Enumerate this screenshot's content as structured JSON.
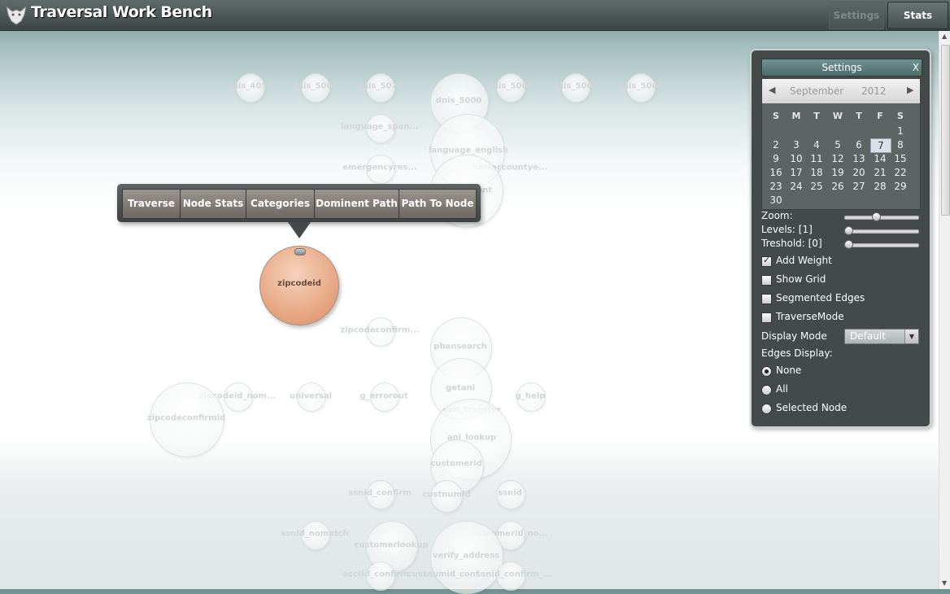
{
  "header": {
    "app_title": "Traversal Work Bench",
    "settings_button": "Settings",
    "stats_button": "Stats"
  },
  "context_menu": [
    "Traverse",
    "Node Stats",
    "Categories",
    "Dominent Path",
    "Path To Node"
  ],
  "selected_node": "zipcodeid",
  "graph_nodes": [
    "dnis_4058",
    "dnis_5002",
    "dnis_5075",
    "dnis_5000",
    "dnis_5004",
    "dnis_5001",
    "dnis_5003",
    "language_span...",
    "language_english",
    "emergencyres...",
    "newaccountye...",
    "...ant",
    "zipcodeconfirm...",
    "pbansearch",
    "zipcodeid_nom...",
    "universal",
    "g_errorout",
    "getani",
    "g_help",
    "zipcodeconfirmid",
    "exit_transfer",
    "ani_lookup",
    "customerid",
    "ssnid_confirm",
    "custnumid",
    "ssnid",
    "ssnid_nomatch",
    "customerlookup",
    "customerid_no...",
    "verify_address",
    "acctid_confirm",
    "custnumid_conf",
    "ssnid_confirm_..."
  ],
  "settings": {
    "title": "Settings",
    "close": "X",
    "calendar": {
      "month": "September",
      "year": "2012",
      "weekdays": [
        "S",
        "M",
        "T",
        "W",
        "T",
        "F",
        "S"
      ],
      "selected_day": "7",
      "weeks": [
        [
          "",
          "",
          "",
          "",
          "",
          "",
          "1"
        ],
        [
          "2",
          "3",
          "4",
          "5",
          "6",
          "7",
          "8"
        ],
        [
          "9",
          "10",
          "11",
          "12",
          "13",
          "14",
          "15"
        ],
        [
          "16",
          "17",
          "18",
          "19",
          "20",
          "21",
          "22"
        ],
        [
          "23",
          "24",
          "25",
          "26",
          "27",
          "28",
          "29"
        ],
        [
          "30",
          "",
          "",
          "",
          "",
          "",
          ""
        ]
      ]
    },
    "zoom_label": "Zoom:",
    "zoom_value": 0.42,
    "levels_label": "Levels: [1]",
    "levels_value": 0,
    "treshold_label": "Treshold: [0]",
    "treshold_value": 0,
    "checkboxes": [
      {
        "label": "Add Weight",
        "checked": true
      },
      {
        "label": "Show Grid",
        "checked": false
      },
      {
        "label": "Segmented Edges",
        "checked": false
      },
      {
        "label": "TraverseMode",
        "checked": false
      }
    ],
    "display_mode_label": "Display Mode",
    "display_mode_value": "Default",
    "edges_display_label": "Edges Display:",
    "edges_options": [
      {
        "label": "None",
        "selected": true
      },
      {
        "label": "All",
        "selected": false
      },
      {
        "label": "Selected Node",
        "selected": false
      }
    ]
  }
}
